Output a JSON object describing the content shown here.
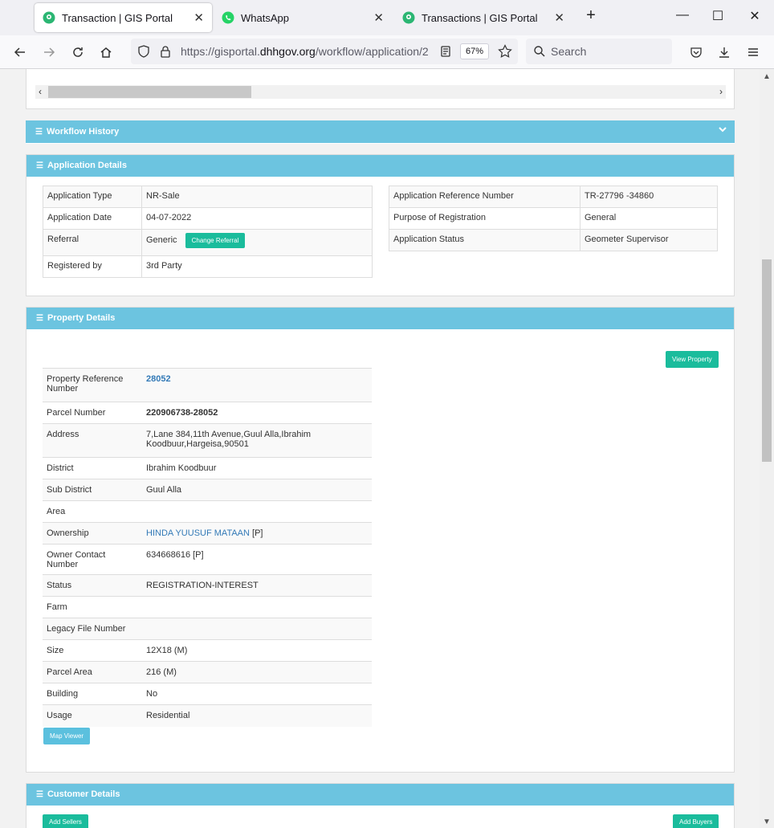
{
  "browser": {
    "tabs": [
      {
        "title": "Transaction | GIS Portal",
        "active": true
      },
      {
        "title": "WhatsApp",
        "active": false
      },
      {
        "title": "Transactions | GIS Portal",
        "active": false
      }
    ],
    "url_prefix": "https://gisportal.",
    "url_domain": "dhhgov.org",
    "url_path": "/workflow/application/2",
    "zoom": "67%",
    "search_placeholder": "Search"
  },
  "workflow_history": {
    "title": "Workflow History"
  },
  "application_details": {
    "title": "Application Details",
    "left": [
      {
        "label": "Application Type",
        "value": "NR-Sale"
      },
      {
        "label": "Application Date",
        "value": "04-07-2022"
      },
      {
        "label": "Referral",
        "value": "Generic"
      },
      {
        "label": "Registered by",
        "value": "3rd Party"
      }
    ],
    "change_referral_label": "Change Referral",
    "right": [
      {
        "label": "Application Reference Number",
        "value": "TR-27796 -34860"
      },
      {
        "label": "Purpose of Registration",
        "value": "General"
      },
      {
        "label": "Application Status",
        "value": "Geometer Supervisor"
      }
    ]
  },
  "property_details": {
    "title": "Property Details",
    "view_property_label": "View Property",
    "map_viewer_label": "Map Viewer",
    "rows": [
      {
        "label": "Property Reference Number",
        "value": "28052"
      },
      {
        "label": "Parcel Number",
        "value": "220906738-28052"
      },
      {
        "label": "Address",
        "value": "7,Lane 384,11th Avenue,Guul Alla,Ibrahim Koodbuur,Hargeisa,90501"
      },
      {
        "label": "District",
        "value": "Ibrahim Koodbuur"
      },
      {
        "label": "Sub District",
        "value": "Guul Alla"
      },
      {
        "label": "Area",
        "value": ""
      },
      {
        "label": "Ownership",
        "value": "HINDA YUUSUF MATAAN",
        "suffix": "[P]"
      },
      {
        "label": "Owner Contact Number",
        "value": "634668616 [P]"
      },
      {
        "label": "Status",
        "value": "REGISTRATION-INTEREST"
      },
      {
        "label": "Farm",
        "value": ""
      },
      {
        "label": "Legacy File Number",
        "value": ""
      },
      {
        "label": "Size",
        "value": "12X18 (M)"
      },
      {
        "label": "Parcel Area",
        "value": "216 (M)"
      },
      {
        "label": "Building",
        "value": "No"
      },
      {
        "label": "Usage",
        "value": "Residential"
      }
    ]
  },
  "customer_details": {
    "title": "Customer Details",
    "add_sellers_label": "Add Sellers",
    "add_buyers_label": "Add Buyers"
  },
  "colors": {
    "header": "#6cc4e0",
    "green": "#1abc9c",
    "blue_button": "#5bc0de",
    "link": "#337ab7"
  }
}
